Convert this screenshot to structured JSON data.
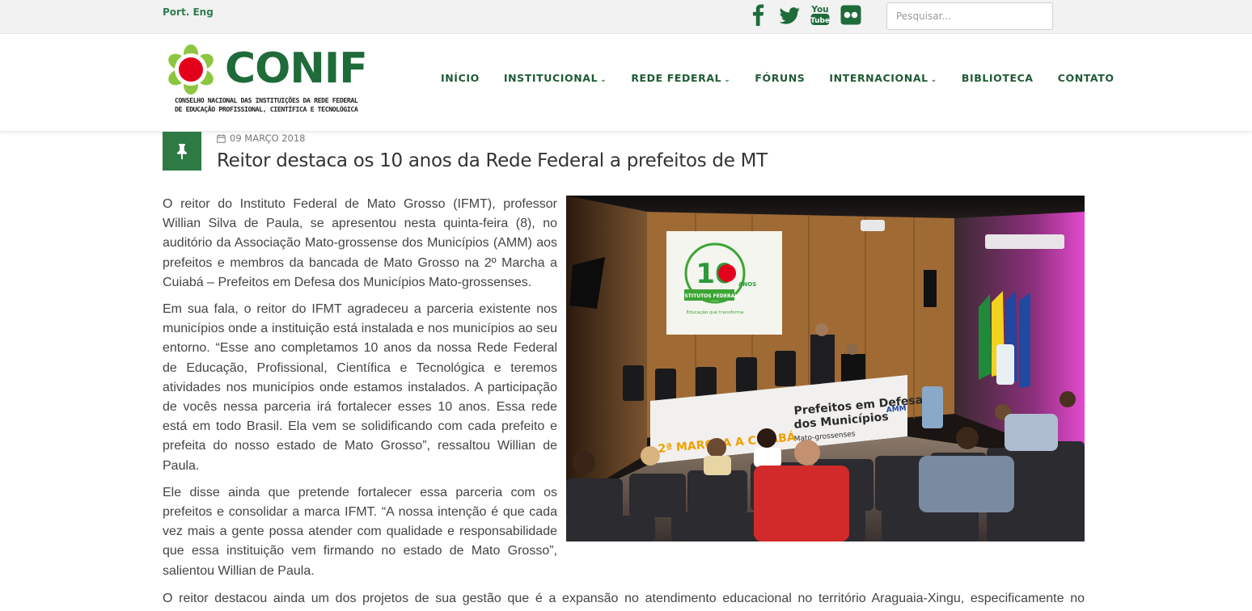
{
  "topbar": {
    "lang_pt": "Port.",
    "lang_en": "Eng",
    "social": [
      "facebook-icon",
      "twitter-icon",
      "youtube-icon",
      "flickr-icon"
    ],
    "search_placeholder": "Pesquisar..."
  },
  "brand": {
    "name": "CONIF",
    "subtitle_line1": "CONSELHO NACIONAL DAS INSTITUIÇÕES DA REDE FEDERAL",
    "subtitle_line2": "DE EDUCAÇÃO PROFISSIONAL, CIENTÍFICA E TECNOLÓGICA",
    "colors": {
      "green": "#1f6b3a",
      "red": "#e3001b",
      "light_green": "#8cc63f"
    }
  },
  "nav": {
    "items": [
      {
        "label": "INÍCIO",
        "dropdown": false
      },
      {
        "label": "INSTITUCIONAL",
        "dropdown": true
      },
      {
        "label": "REDE FEDERAL",
        "dropdown": true
      },
      {
        "label": "FÓRUNS",
        "dropdown": false
      },
      {
        "label": "INTERNACIONAL",
        "dropdown": true
      },
      {
        "label": "BIBLIOTECA",
        "dropdown": false
      },
      {
        "label": "CONTATO",
        "dropdown": false
      }
    ]
  },
  "article": {
    "pin_icon": "pin-icon",
    "date_icon": "calendar-icon",
    "date": "09 MARÇO 2018",
    "title": "Reitor destaca os 10 anos da Rede Federal a prefeitos de MT",
    "paragraphs": [
      "O reitor do Instituto Federal de Mato Grosso (IFMT), professor Willian Silva de Paula, se apresentou nesta quinta-feira (8), no auditório da Associação Mato-grossense dos Municípios (AMM) aos prefeitos e membros da bancada de Mato Grosso na 2º Marcha a Cuiabá – Prefeitos em Defesa dos Municípios Mato-grossenses.",
      "Em sua fala, o reitor do IFMT agradeceu a parceria existente nos municípios onde a instituição está instalada e nos municípios ao seu entorno. “Esse ano completamos 10 anos da nossa Rede Federal de Educação, Profissional, Científica e Tecnológica e teremos atividades nos municípios onde estamos instalados. A participação de vocês nessa parceria irá fortalecer esses 10 anos. Essa rede está em todo Brasil. Ela vem se solidificando com cada prefeito e prefeita do nosso estado de Mato Grosso”, ressaltou Willian de Paula.",
      "Ele disse ainda que pretende fortalecer essa parceria com os prefeitos e consolidar a marca IFMT. “A nossa intenção é que cada vez mais a gente possa atender com qualidade e responsabilidade que essa instituição vem firmando no estado de Mato Grosso”, salientou Willian de Paula."
    ],
    "last_line": "O reitor destacou ainda um dos projetos de sua gestão que é a expansão no atendimento educacional no território Araguaia-Xingu, especificamente no",
    "photo": {
      "screen_text_big": "10",
      "screen_text_anos": "ANOS",
      "screen_text_inst": "INSTITUTOS FEDERAIS",
      "screen_text_tag": "Educação que transforma",
      "banner_line1": "Prefeitos em Defesa",
      "banner_line2": "dos Municípios",
      "banner_line3": "Mato-grossenses",
      "banner_marcha": "2ª MARCHA A CUIABÁ",
      "banner_amm": "AMM"
    }
  }
}
